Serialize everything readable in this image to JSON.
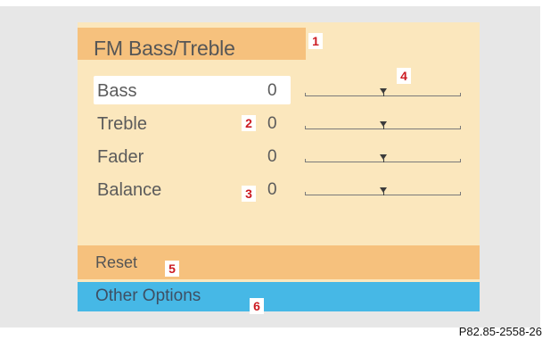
{
  "screen": {
    "title": "FM Bass/Treble",
    "settings": [
      {
        "label": "Bass",
        "value": "0",
        "level": 0.5,
        "selected": true
      },
      {
        "label": "Treble",
        "value": "0",
        "level": 0.5,
        "selected": false
      },
      {
        "label": "Fader",
        "value": "0",
        "level": 0.5,
        "selected": false
      },
      {
        "label": "Balance",
        "value": "0",
        "level": 0.5,
        "selected": false
      }
    ],
    "reset_label": "Reset",
    "other_options_label": "Other Options"
  },
  "callouts": {
    "c1": "1",
    "c2": "2",
    "c3": "3",
    "c4": "4",
    "c5": "5",
    "c6": "6"
  },
  "figure_id": "P82.85-2558-26",
  "colors": {
    "screen_background": "#fbe7bd",
    "title_bar": "#f6c17d",
    "reset_bar": "#f6c17d",
    "options_bar": "#46b8e6",
    "selection": "#ffffff",
    "callout_text": "#cc1b22"
  },
  "icons": {
    "slider_thumb": "down-triangle-marker"
  }
}
